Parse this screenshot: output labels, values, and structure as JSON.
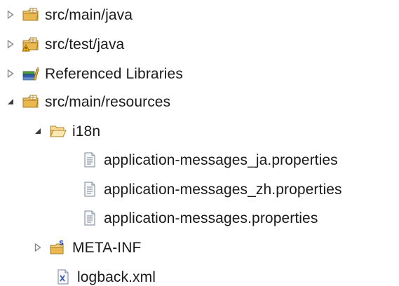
{
  "tree": {
    "src_main_java": {
      "label": "src/main/java"
    },
    "src_test_java": {
      "label": "src/test/java"
    },
    "referenced_libraries": {
      "label": "Referenced Libraries"
    },
    "src_main_resources": {
      "label": "src/main/resources"
    },
    "i18n": {
      "label": "i18n"
    },
    "files": [
      {
        "label": "application-messages_ja.properties"
      },
      {
        "label": "application-messages_zh.properties"
      },
      {
        "label": "application-messages.properties"
      }
    ],
    "meta_inf": {
      "label": "META-INF"
    },
    "logback": {
      "label": "logback.xml"
    }
  },
  "colors": {
    "package_folder": "#e3b14a",
    "package_tint": "#b88a2e",
    "library_green": "#3e8a3a",
    "library_blue": "#2f5fa6",
    "warning": "#e0a000",
    "file_gray": "#8a96a6",
    "xml_blue": "#3b5fa8",
    "twisty_gray": "#8c8c8c",
    "twisty_dark": "#3a3a3a"
  },
  "icons": {
    "package_folder": "package-folder-icon",
    "test_package_folder": "test-package-folder-icon",
    "library": "library-icon",
    "folder_open": "folder-open-icon",
    "properties_file": "properties-file-icon",
    "meta_folder": "meta-inf-folder-icon",
    "xml_file": "xml-file-icon"
  }
}
